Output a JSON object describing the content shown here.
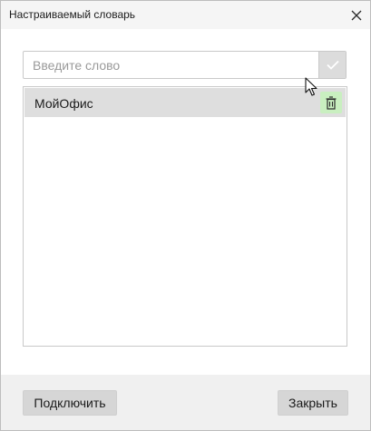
{
  "window": {
    "title": "Настраиваемый словарь"
  },
  "input": {
    "placeholder": "Введите слово",
    "value": ""
  },
  "word_list": {
    "items": [
      {
        "label": "МойОфис",
        "selected": true
      }
    ]
  },
  "footer": {
    "connect_label": "Подключить",
    "close_label": "Закрыть"
  },
  "icons": {
    "close": "close-icon",
    "add": "checkmark-icon",
    "delete": "trash-icon",
    "pointer": "mouse-cursor-icon"
  },
  "colors": {
    "selected_row": "#dedede",
    "delete_hover": "#c9efc0",
    "disabled_button": "#dcdcdc",
    "footer_bg": "#f0f0f0"
  }
}
